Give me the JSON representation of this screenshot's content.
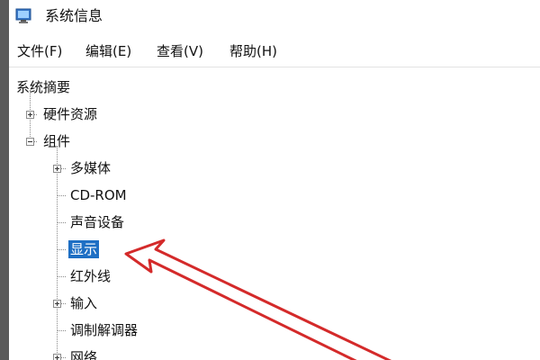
{
  "window": {
    "title": "系统信息",
    "icon": "system-info-icon"
  },
  "menu": [
    "文件(F)",
    "编辑(E)",
    "查看(V)",
    "帮助(H)"
  ],
  "tree": {
    "root": "系统摘要",
    "hardware": "硬件资源",
    "components": "组件",
    "children": [
      "多媒体",
      "CD-ROM",
      "声音设备",
      "显示",
      "红外线",
      "输入",
      "调制解调器",
      "网络"
    ]
  },
  "selected_item": "显示",
  "annotation": {
    "color": "#d42a2a",
    "kind": "red-arrow",
    "target": "显示"
  }
}
